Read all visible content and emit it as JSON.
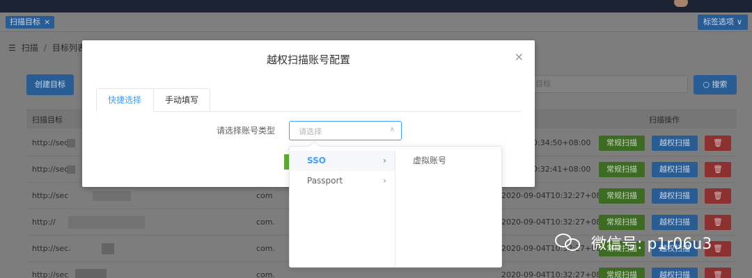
{
  "tagbar": {
    "tag_label": "扫描目标",
    "tag_close": "×",
    "options_label": "标签选项",
    "options_chevron": "∨"
  },
  "breadcrumb": {
    "icon": "list-icon",
    "items": [
      "扫描",
      "目标列表"
    ],
    "separator": "/"
  },
  "page": {
    "create_button": "创建目标",
    "search_placeholder": "目标",
    "search_button": "○ 搜索"
  },
  "table": {
    "headers": {
      "target": "扫描目标",
      "ops": "扫描操作"
    },
    "rows": [
      {
        "url": "http://sec",
        "domain": "",
        "time": "10:34:50+08:00"
      },
      {
        "url": "http://sec",
        "domain": "",
        "time": "10:32:41+08:00"
      },
      {
        "url": "http://sec",
        "domain": "com",
        "time": "2020-09-04T10:32:27+08:00"
      },
      {
        "url": "http://",
        "domain": "com.",
        "time": "2020-09-04T10:32:27+08:00"
      },
      {
        "url": "http://sec.",
        "domain": "com.",
        "time": "2020-09-04T10:32:27+08:00"
      },
      {
        "url": "http://sec",
        "domain": "com.",
        "time": "2020-09-04T10:32:27+08:00"
      }
    ],
    "btn_normal": "常规扫描",
    "btn_priv": "越权扫描",
    "btn_delete_icon": "trash-icon"
  },
  "modal": {
    "title": "越权扫描账号配置",
    "close": "×",
    "tabs": [
      "快捷选择",
      "手动填写"
    ],
    "form_label": "请选择账号类型",
    "select_placeholder": "请选择",
    "select_arrow": "∧"
  },
  "cascader": {
    "level1": [
      {
        "label": "SSO",
        "active": true
      },
      {
        "label": "Passport",
        "active": false
      }
    ],
    "level2": [
      {
        "label": "虚拟账号"
      }
    ],
    "chevron": "›"
  },
  "watermark": {
    "text": "微信号: p1r06u3"
  },
  "colors": {
    "primary": "#409eff",
    "success": "#67c23a",
    "danger": "#f56c6c",
    "overlay": "#7d7d7d"
  }
}
